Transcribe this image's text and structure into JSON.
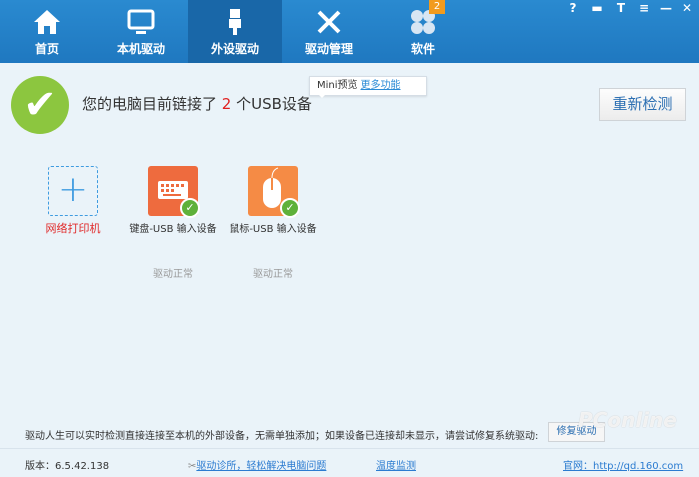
{
  "nav": {
    "tabs": [
      {
        "label": "首页",
        "icon": "home-icon"
      },
      {
        "label": "本机驱动",
        "icon": "monitor-icon"
      },
      {
        "label": "外设驱动",
        "icon": "usb-icon",
        "active": true
      },
      {
        "label": "驱动管理",
        "icon": "tools-icon"
      },
      {
        "label": "软件",
        "icon": "clover-icon",
        "badge": "2"
      }
    ]
  },
  "window_controls": {
    "help": "?",
    "feedback": "▬",
    "skin": "T",
    "menu": "≡",
    "minimize": "—",
    "close": "✕"
  },
  "status": {
    "prefix": "您的电脑目前链接了",
    "count": "2",
    "suffix": "个USB设备"
  },
  "tooltip": {
    "text": "Mini预览",
    "link": "更多功能"
  },
  "recheck_label": "重新检测",
  "devices": [
    {
      "name": "网络打印机",
      "status": ""
    },
    {
      "name": "键盘-USB 输入设备",
      "status": "驱动正常"
    },
    {
      "name": "鼠标-USB 输入设备",
      "status": "驱动正常"
    }
  ],
  "hint": "驱动人生可以实时检测直接连接至本机的外部设备，无需单独添加；如果设备已连接却未显示，请尝试修复系统驱动:",
  "fix_label": "修复驱动",
  "footer": {
    "version": "版本：6.5.42.138",
    "diag": "驱动诊所，轻松解决电脑问题",
    "temp": "温度监测",
    "site": "官网：http://qd.160.com"
  },
  "watermark": "PConline 太平洋电脑网",
  "colors": {
    "header": "#2180c8",
    "active_tab": "#1967a8",
    "check": "#8cc63f",
    "count": "#e02020"
  }
}
